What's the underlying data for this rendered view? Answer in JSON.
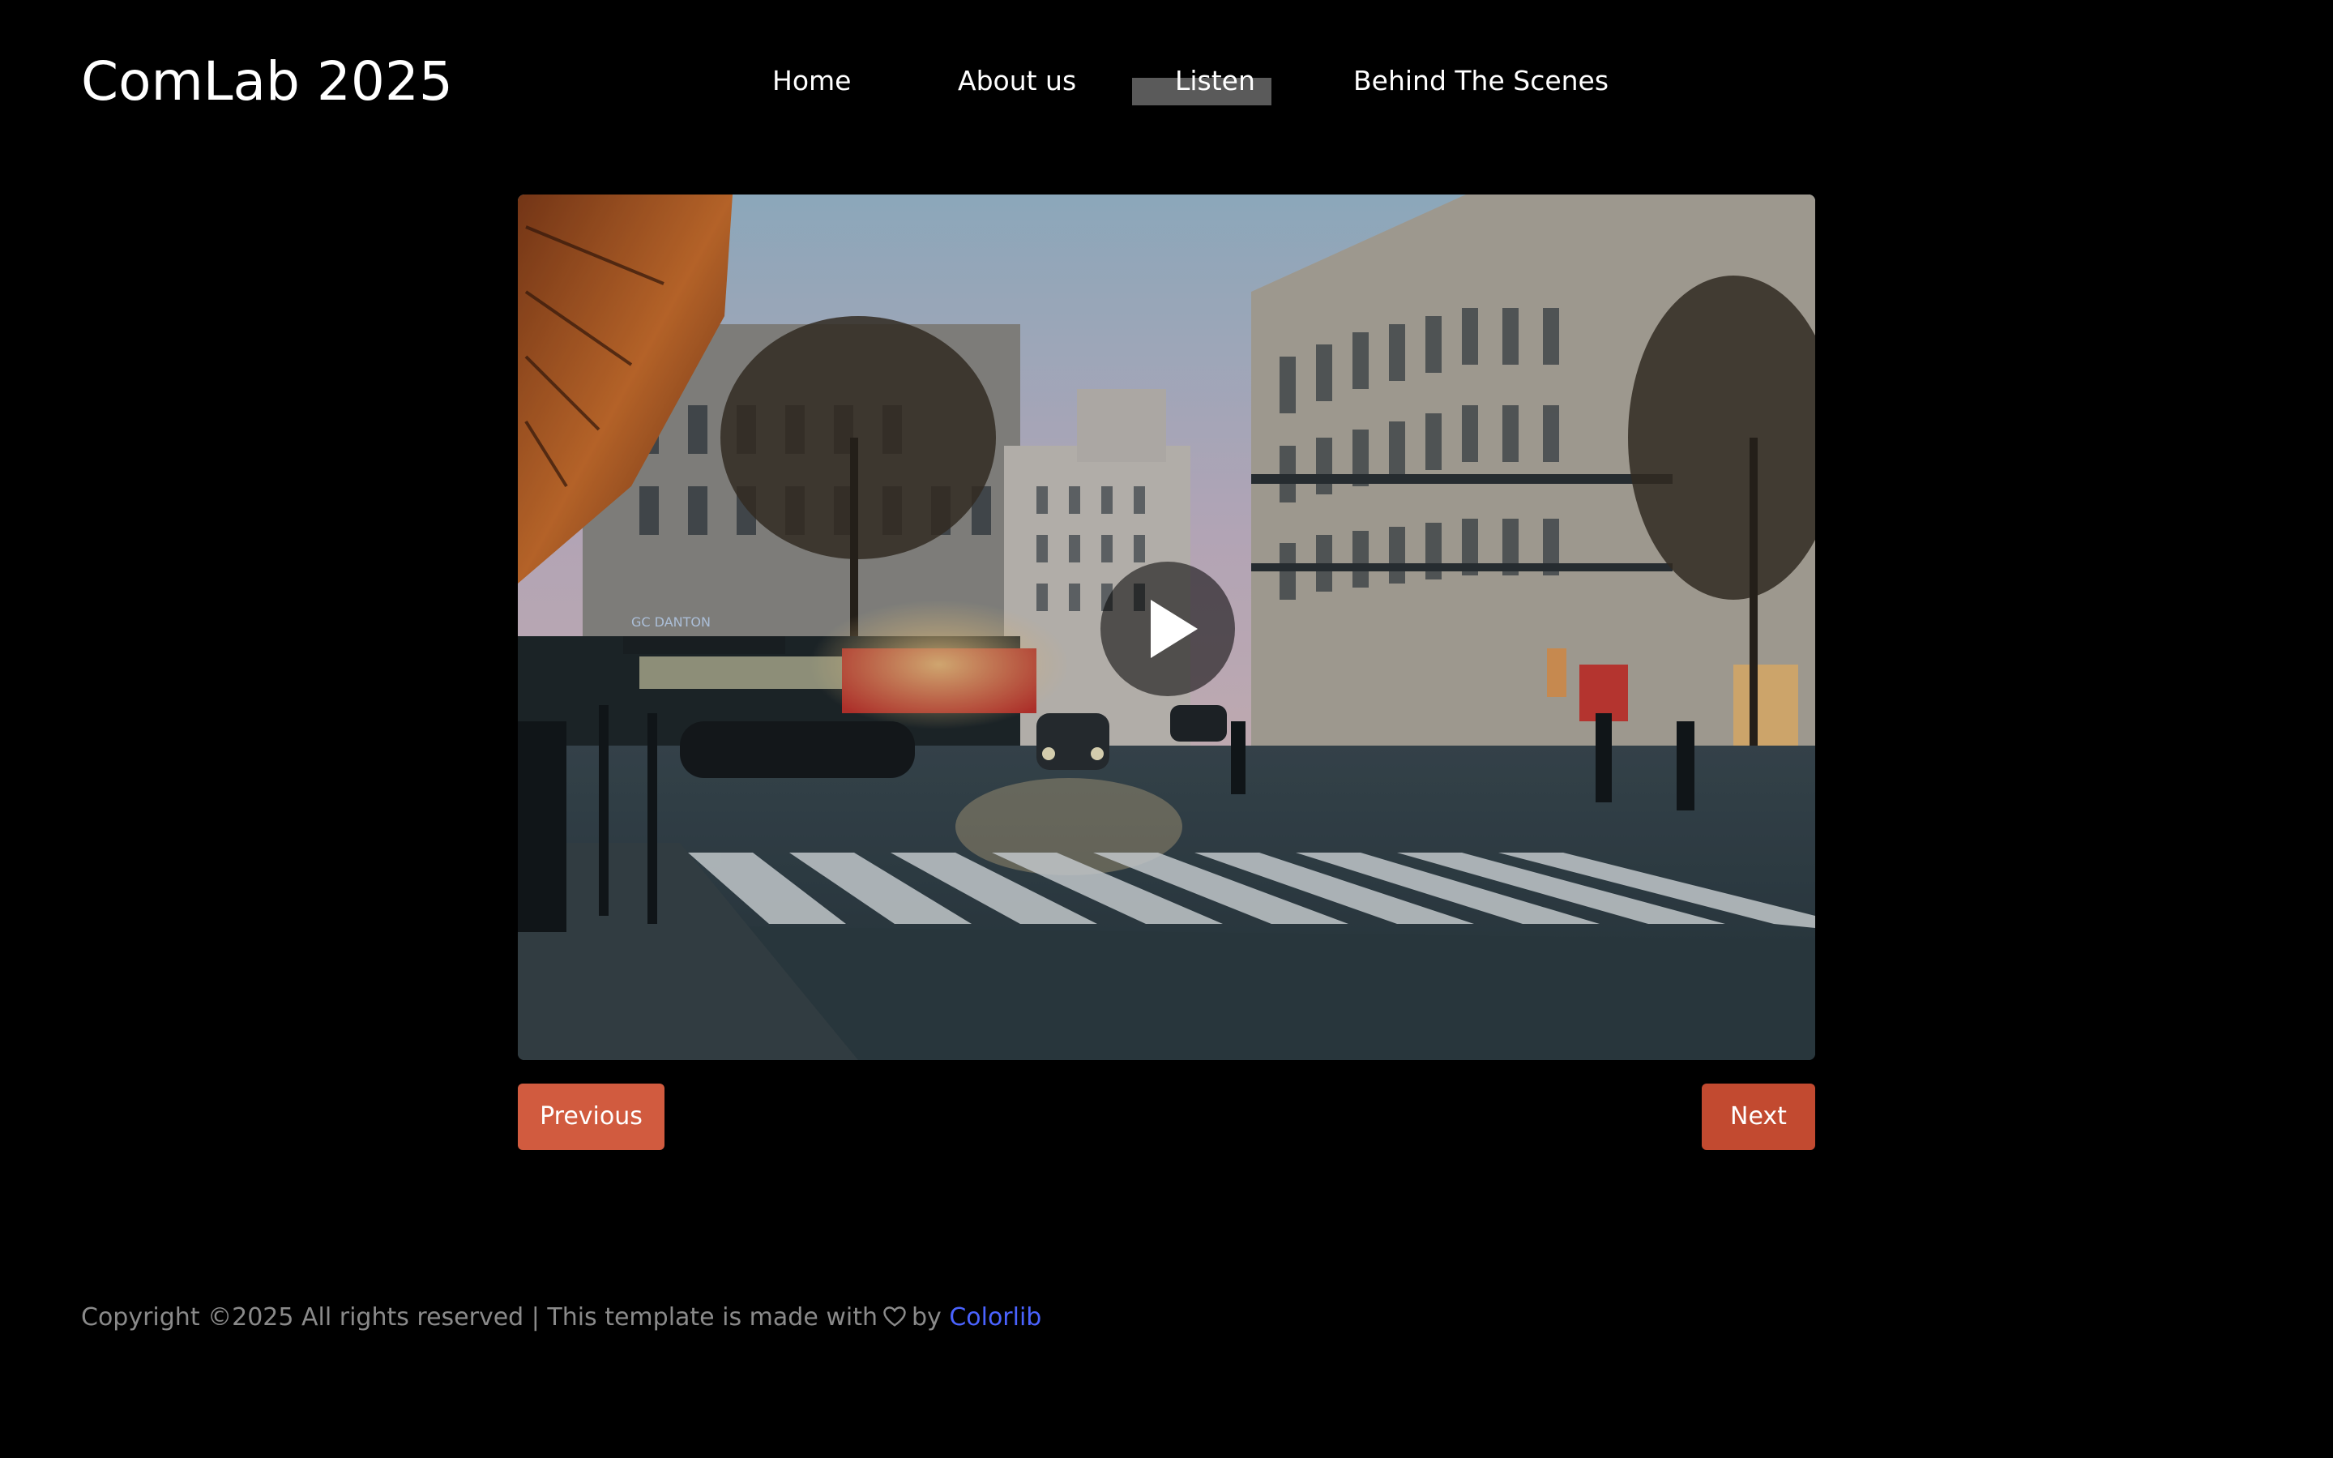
{
  "brand": {
    "title": "ComLab 2025"
  },
  "nav": {
    "items": [
      {
        "label": "Home"
      },
      {
        "label": "About us"
      },
      {
        "label": "Listen",
        "active": true
      },
      {
        "label": "Behind The Scenes"
      }
    ]
  },
  "video": {
    "play_icon": "play-icon",
    "scene_sign": "GC DANTON"
  },
  "pager": {
    "previous_label": "Previous",
    "next_label": "Next"
  },
  "footer": {
    "copyright_text": "Copyright ©2025 All rights reserved | This template is made with",
    "heart_icon": "heart-icon",
    "by_text": "by",
    "link_label": "Colorlib"
  },
  "colors": {
    "background": "#000000",
    "button_previous": "#d15b3f",
    "button_next": "#c24a30",
    "nav_active_highlight": "#5a5a5a",
    "footer_text": "#8a8a8a",
    "footer_link": "#4a63ff"
  }
}
